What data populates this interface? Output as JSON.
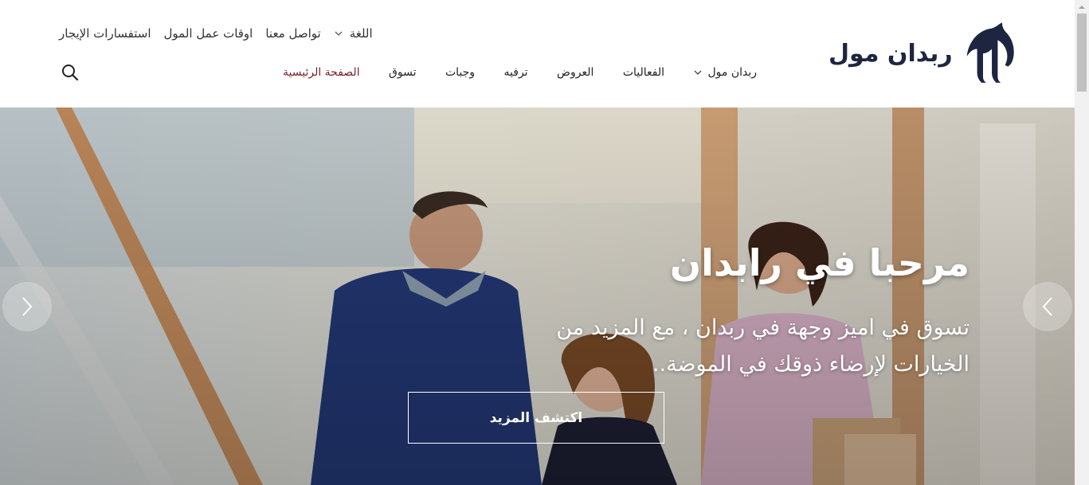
{
  "header": {
    "logo_text": "ربدان مول",
    "utility_links": [
      {
        "label": "استفسارات الإيجار"
      },
      {
        "label": "اوقات عمل المول"
      },
      {
        "label": "تواصل معنا"
      }
    ],
    "language_label": "اللغة",
    "nav": [
      {
        "label": "الصفحة الرئيسية",
        "active": true
      },
      {
        "label": "تسوق"
      },
      {
        "label": "وجبات"
      },
      {
        "label": "ترفيه"
      },
      {
        "label": "العروض"
      },
      {
        "label": "الفعاليات"
      },
      {
        "label": "ربدان مول",
        "dropdown": true
      }
    ],
    "search_icon": "search-icon"
  },
  "hero": {
    "title": "مرحبا في رابدان",
    "subtitle": "تسوق في اميز وجهة في ربدان ، مع المزيد من الخيارات لإرضاء ذوقك في الموضة..",
    "button_label": "اكتشف المزيد",
    "prev_icon": "chevron-left-icon",
    "next_icon": "chevron-left-icon"
  },
  "colors": {
    "brand_navy": "#1d2540",
    "active_nav": "#7a1f2b",
    "hero_text": "#ffffff"
  }
}
